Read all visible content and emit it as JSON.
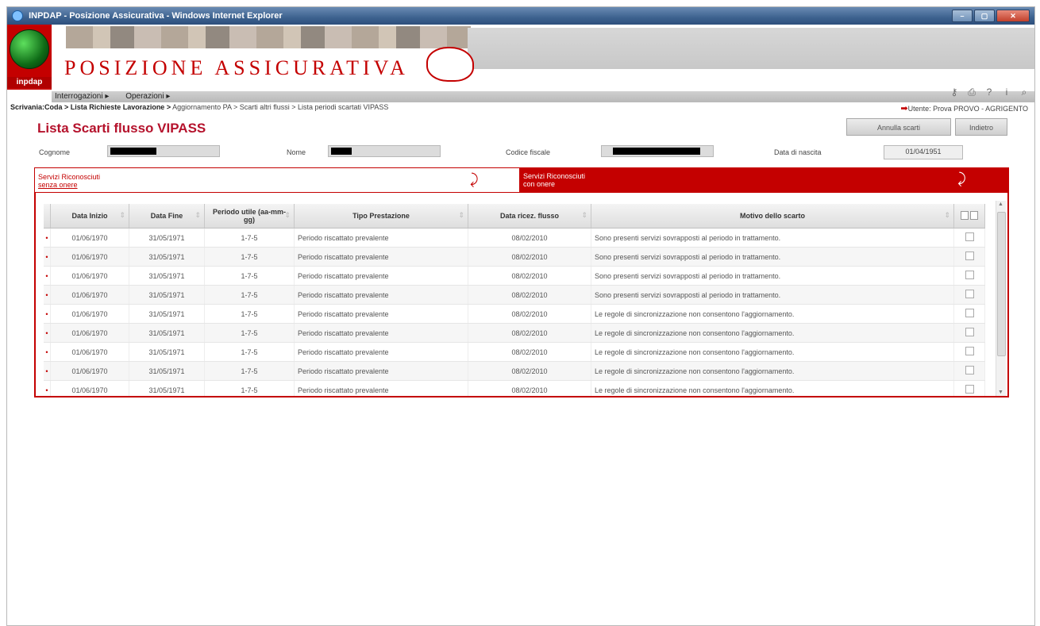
{
  "window": {
    "title": "INPDAP - Posizione Assicurativa - Windows Internet Explorer"
  },
  "header": {
    "app_title": "POSIZIONE ASSICURATIVA",
    "logo_text": "inpdap",
    "menu": [
      "Interrogazioni",
      "Operazioni"
    ]
  },
  "breadcrumb": {
    "bold": "Scrivania:Coda > Lista Richieste Lavorazione >",
    "rest": " Aggiornamento PA > Scarti altri flussi > Lista periodi scartati VIPASS"
  },
  "user": {
    "label": "Utente: Prova PROVO - AGRIGENTO"
  },
  "page": {
    "title": "Lista Scarti flusso VIPASS",
    "buttons": {
      "annulla": "Annulla scarti",
      "indietro": "Indietro"
    }
  },
  "fields": {
    "cognome_label": "Cognome",
    "nome_label": "Nome",
    "codice_fiscale_label": "Codice fiscale",
    "data_nascita_label": "Data di nascita",
    "data_nascita_value": "01/04/1951"
  },
  "tabs": {
    "left": {
      "line1": "Servizi Riconosciuti",
      "line2": "senza onere"
    },
    "right": {
      "line1": "Servizi Riconosciuti",
      "line2": "con onere"
    }
  },
  "table": {
    "headers": [
      "Data Inizio",
      "Data Fine",
      "Periodo utile (aa-mm-gg)",
      "Tipo Prestazione",
      "Data ricez. flusso",
      "Motivo dello scarto"
    ],
    "rows": [
      {
        "inizio": "01/06/1970",
        "fine": "31/05/1971",
        "periodo": "1-7-5",
        "tipo": "Periodo riscattato prevalente",
        "ricez": "08/02/2010",
        "motivo": "Sono presenti servizi sovrapposti al periodo in trattamento."
      },
      {
        "inizio": "01/06/1970",
        "fine": "31/05/1971",
        "periodo": "1-7-5",
        "tipo": "Periodo riscattato prevalente",
        "ricez": "08/02/2010",
        "motivo": "Sono presenti servizi sovrapposti al periodo in trattamento."
      },
      {
        "inizio": "01/06/1970",
        "fine": "31/05/1971",
        "periodo": "1-7-5",
        "tipo": "Periodo riscattato prevalente",
        "ricez": "08/02/2010",
        "motivo": "Sono presenti servizi sovrapposti al periodo in trattamento."
      },
      {
        "inizio": "01/06/1970",
        "fine": "31/05/1971",
        "periodo": "1-7-5",
        "tipo": "Periodo riscattato prevalente",
        "ricez": "08/02/2010",
        "motivo": "Sono presenti servizi sovrapposti al periodo in trattamento."
      },
      {
        "inizio": "01/06/1970",
        "fine": "31/05/1971",
        "periodo": "1-7-5",
        "tipo": "Periodo riscattato prevalente",
        "ricez": "08/02/2010",
        "motivo": "Le regole di sincronizzazione non consentono l'aggiornamento."
      },
      {
        "inizio": "01/06/1970",
        "fine": "31/05/1971",
        "periodo": "1-7-5",
        "tipo": "Periodo riscattato prevalente",
        "ricez": "08/02/2010",
        "motivo": "Le regole di sincronizzazione non consentono l'aggiornamento."
      },
      {
        "inizio": "01/06/1970",
        "fine": "31/05/1971",
        "periodo": "1-7-5",
        "tipo": "Periodo riscattato prevalente",
        "ricez": "08/02/2010",
        "motivo": "Le regole di sincronizzazione non consentono l'aggiornamento."
      },
      {
        "inizio": "01/06/1970",
        "fine": "31/05/1971",
        "periodo": "1-7-5",
        "tipo": "Periodo riscattato prevalente",
        "ricez": "08/02/2010",
        "motivo": "Le regole di sincronizzazione non consentono l'aggiornamento."
      },
      {
        "inizio": "01/06/1970",
        "fine": "31/05/1971",
        "periodo": "1-7-5",
        "tipo": "Periodo riscattato prevalente",
        "ricez": "08/02/2010",
        "motivo": "Le regole di sincronizzazione non consentono l'aggiornamento."
      }
    ]
  },
  "colors": {
    "brand_red": "#c40000",
    "title_red": "#b5122c"
  }
}
